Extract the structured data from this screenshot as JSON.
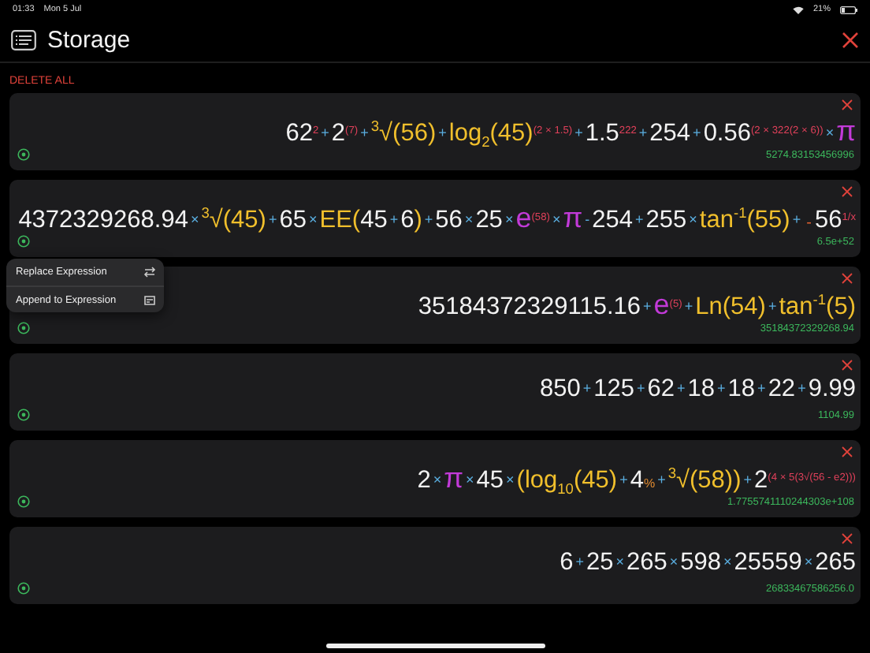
{
  "status_bar": {
    "time": "01:33",
    "date": "Mon 5 Jul",
    "battery": "21%"
  },
  "header": {
    "title": "Storage"
  },
  "delete_all": "DELETE ALL",
  "entries": [
    {
      "tokens": [
        {
          "kind": "num",
          "text": "62"
        },
        {
          "kind": "sup",
          "text": "$^{2}$"
        },
        {
          "kind": "op",
          "text": "+"
        },
        {
          "kind": "num",
          "text": "2"
        },
        {
          "kind": "sup",
          "text": "$^{(7)}$"
        },
        {
          "kind": "op",
          "text": "+"
        },
        {
          "kind": "fn",
          "text": "$^{3}$√(56)"
        },
        {
          "kind": "op",
          "text": "+"
        },
        {
          "kind": "fn",
          "text": "log$_{2}$(45)"
        },
        {
          "kind": "sup",
          "text": "$^{(2 × 1.5)}$"
        },
        {
          "kind": "op",
          "text": "+"
        },
        {
          "kind": "num",
          "text": "1.5"
        },
        {
          "kind": "sup",
          "text": "$^{2}$$^{22}$"
        },
        {
          "kind": "op",
          "text": "+"
        },
        {
          "kind": "num",
          "text": "254"
        },
        {
          "kind": "op",
          "text": "+"
        },
        {
          "kind": "num",
          "text": "0.56"
        },
        {
          "kind": "sup",
          "text": "$^{(2 × 3}$$^{22(2 × 6)}$$^{)}$"
        },
        {
          "kind": "op",
          "text": "×"
        },
        {
          "kind": "const",
          "text": "π"
        }
      ],
      "result": "5274.83153456996"
    },
    {
      "tokens": [
        {
          "kind": "num",
          "text": "4372329268.94"
        },
        {
          "kind": "op",
          "text": "×"
        },
        {
          "kind": "fn",
          "text": "$^{3}$√(45)"
        },
        {
          "kind": "op",
          "text": "+"
        },
        {
          "kind": "num",
          "text": "65"
        },
        {
          "kind": "op",
          "text": "×"
        },
        {
          "kind": "fn",
          "text": "EE("
        },
        {
          "kind": "num",
          "text": "45"
        },
        {
          "kind": "op",
          "text": "+"
        },
        {
          "kind": "num",
          "text": "6"
        },
        {
          "kind": "fn",
          "text": ")"
        },
        {
          "kind": "op",
          "text": "+"
        },
        {
          "kind": "num",
          "text": "56"
        },
        {
          "kind": "op",
          "text": "×"
        },
        {
          "kind": "num",
          "text": "25"
        },
        {
          "kind": "op",
          "text": "×"
        },
        {
          "kind": "const",
          "text": "e"
        },
        {
          "kind": "sup",
          "text": "$^{(58)}$"
        },
        {
          "kind": "op",
          "text": "×"
        },
        {
          "kind": "const",
          "text": "π"
        },
        {
          "kind": "op",
          "text": "-"
        },
        {
          "kind": "num",
          "text": "254"
        },
        {
          "kind": "op",
          "text": "+"
        },
        {
          "kind": "num",
          "text": "255"
        },
        {
          "kind": "op",
          "text": "×"
        },
        {
          "kind": "fn",
          "text": "tan$^{-1}$(55)"
        },
        {
          "kind": "op",
          "text": "+"
        },
        {
          "kind": "neg",
          "text": "-"
        },
        {
          "kind": "num",
          "text": "56"
        },
        {
          "kind": "sup",
          "text": "$^{1/x}$"
        }
      ],
      "result": "6.5e+52"
    },
    {
      "tokens": [
        {
          "kind": "num",
          "text": "35184372329115.16"
        },
        {
          "kind": "op",
          "text": "+"
        },
        {
          "kind": "const",
          "text": "e"
        },
        {
          "kind": "sup",
          "text": "$^{(5)}$"
        },
        {
          "kind": "op",
          "text": "+"
        },
        {
          "kind": "fn",
          "text": "Ln(54)"
        },
        {
          "kind": "op",
          "text": "+"
        },
        {
          "kind": "fn",
          "text": "tan$^{-1}$(5)"
        }
      ],
      "result": "35184372329268.94",
      "context_menu": [
        {
          "label": "Replace Expression",
          "kind": "swap"
        },
        {
          "label": "Append to Expression",
          "kind": "append"
        }
      ]
    },
    {
      "tokens": [
        {
          "kind": "num",
          "text": "850"
        },
        {
          "kind": "op",
          "text": "+"
        },
        {
          "kind": "num",
          "text": "125"
        },
        {
          "kind": "op",
          "text": "+"
        },
        {
          "kind": "num",
          "text": "62"
        },
        {
          "kind": "op",
          "text": "+"
        },
        {
          "kind": "num",
          "text": "18"
        },
        {
          "kind": "op",
          "text": "+"
        },
        {
          "kind": "num",
          "text": "18"
        },
        {
          "kind": "op",
          "text": "+"
        },
        {
          "kind": "num",
          "text": "22"
        },
        {
          "kind": "op",
          "text": "+"
        },
        {
          "kind": "num",
          "text": "9.99"
        }
      ],
      "result": "1104.99"
    },
    {
      "tokens": [
        {
          "kind": "num",
          "text": "2"
        },
        {
          "kind": "op",
          "text": "×"
        },
        {
          "kind": "const",
          "text": "π"
        },
        {
          "kind": "op",
          "text": "×"
        },
        {
          "kind": "num",
          "text": "45"
        },
        {
          "kind": "op",
          "text": "×"
        },
        {
          "kind": "fn",
          "text": "(log$_{10}$(45)"
        },
        {
          "kind": "op",
          "text": "+"
        },
        {
          "kind": "num",
          "text": "4"
        },
        {
          "kind": "pct",
          "text": "%"
        },
        {
          "kind": "op",
          "text": "+"
        },
        {
          "kind": "fn",
          "text": "$^{3}$√(58))"
        },
        {
          "kind": "op",
          "text": "+"
        },
        {
          "kind": "num",
          "text": "2"
        },
        {
          "kind": "sup",
          "text": "$^{(4 × 5}$$^{(3√(56 - e2))}$$^{)}$"
        }
      ],
      "result": "1.7755741110244303e+108"
    },
    {
      "tokens": [
        {
          "kind": "num",
          "text": "6"
        },
        {
          "kind": "op",
          "text": "+"
        },
        {
          "kind": "num",
          "text": "25"
        },
        {
          "kind": "op",
          "text": "×"
        },
        {
          "kind": "num",
          "text": "265"
        },
        {
          "kind": "op",
          "text": "×"
        },
        {
          "kind": "num",
          "text": "598"
        },
        {
          "kind": "op",
          "text": "×"
        },
        {
          "kind": "num",
          "text": "25559"
        },
        {
          "kind": "op",
          "text": "×"
        },
        {
          "kind": "num",
          "text": "265"
        }
      ],
      "result": "26833467586256.0"
    }
  ]
}
